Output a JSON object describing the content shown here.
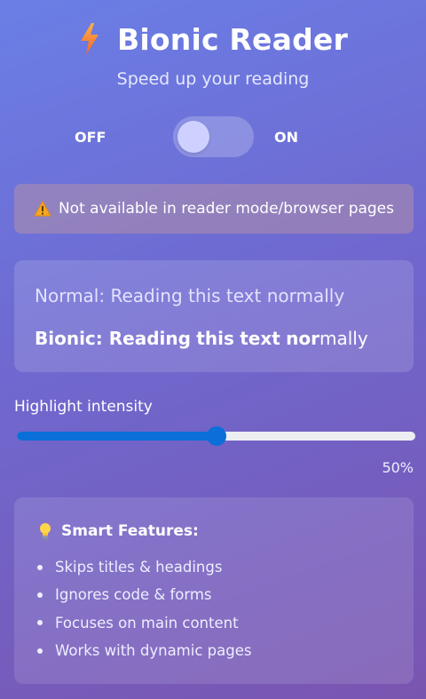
{
  "header": {
    "icon": "lightning-bolt-icon",
    "title": "Bionic Reader",
    "subtitle": "Speed up your reading"
  },
  "toggle": {
    "off_label": "OFF",
    "on_label": "ON",
    "state": "off"
  },
  "warning": {
    "icon": "warning-icon",
    "text": "Not available in reader mode/browser pages"
  },
  "demo": {
    "normal_prefix": "Normal: ",
    "normal_text": "Reading this text normally",
    "bionic_prefix": "Bionic: ",
    "bionic_words": [
      {
        "bold": "Reading",
        "rest": ""
      },
      {
        "bold": "this",
        "rest": ""
      },
      {
        "bold": "text",
        "rest": ""
      },
      {
        "bold": "nor",
        "rest": "mally"
      }
    ]
  },
  "slider": {
    "label": "Highlight intensity",
    "value": 50,
    "value_text": "50%",
    "fill_color": "#0a6fd8"
  },
  "features": {
    "icon": "lightbulb-icon",
    "title": "Smart Features:",
    "items": [
      "Skips titles & headings",
      "Ignores code & forms",
      "Focuses on main content",
      "Works with dynamic pages"
    ]
  }
}
